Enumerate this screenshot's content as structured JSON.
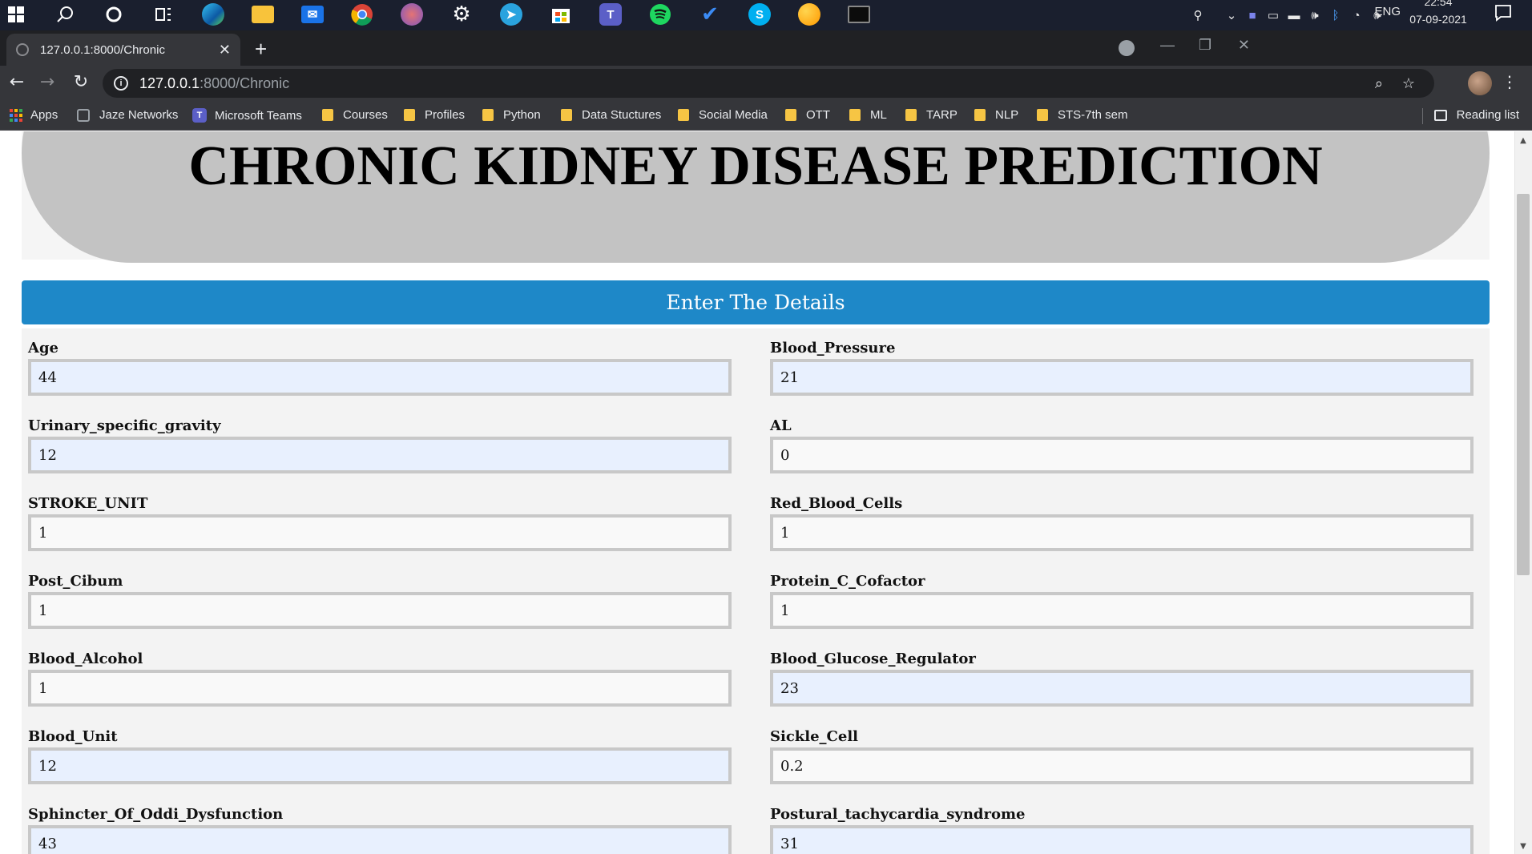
{
  "taskbar": {
    "icons": [
      "windows-start",
      "search",
      "cortana",
      "task-view",
      "edge",
      "file-explorer",
      "mail",
      "chrome",
      "paint",
      "settings",
      "telegram",
      "store",
      "teams",
      "spotify",
      "todo",
      "skype",
      "weather",
      "terminal"
    ],
    "tray": {
      "language": "ENG",
      "time": "22:54",
      "date": "07-09-2021"
    }
  },
  "browser": {
    "tab": {
      "title": "127.0.0.1:8000/Chronic"
    },
    "address": {
      "host": "127.0.0.1",
      "path": ":8000/Chronic"
    },
    "bookmarks": [
      {
        "label": "Apps",
        "type": "apps"
      },
      {
        "label": "Jaze Networks",
        "type": "page"
      },
      {
        "label": "Microsoft Teams",
        "type": "teams"
      },
      {
        "label": "Courses",
        "type": "folder"
      },
      {
        "label": "Profiles",
        "type": "folder"
      },
      {
        "label": "Python",
        "type": "folder"
      },
      {
        "label": "Data Stuctures",
        "type": "folder"
      },
      {
        "label": "Social Media",
        "type": "folder"
      },
      {
        "label": "OTT",
        "type": "folder"
      },
      {
        "label": "ML",
        "type": "folder"
      },
      {
        "label": "TARP",
        "type": "folder"
      },
      {
        "label": "NLP",
        "type": "folder"
      },
      {
        "label": "STS-7th sem",
        "type": "folder"
      }
    ],
    "reading_list": "Reading list"
  },
  "page": {
    "title": "CHRONIC KIDNEY DISEASE PREDICTION",
    "section_header": "Enter The Details",
    "fields": [
      {
        "label": "Age",
        "value": "44",
        "autofilled": true
      },
      {
        "label": "Blood_Pressure",
        "value": "21",
        "autofilled": true
      },
      {
        "label": "Urinary_specific_gravity",
        "value": "12",
        "autofilled": true
      },
      {
        "label": "AL",
        "value": "0",
        "autofilled": false
      },
      {
        "label": "STROKE_UNIT",
        "value": "1",
        "autofilled": false
      },
      {
        "label": "Red_Blood_Cells",
        "value": "1",
        "autofilled": false
      },
      {
        "label": "Post_Cibum",
        "value": "1",
        "autofilled": false
      },
      {
        "label": "Protein_C_Cofactor",
        "value": "1",
        "autofilled": false
      },
      {
        "label": "Blood_Alcohol",
        "value": "1",
        "autofilled": false
      },
      {
        "label": "Blood_Glucose_Regulator",
        "value": "23",
        "autofilled": true
      },
      {
        "label": "Blood_Unit",
        "value": "12",
        "autofilled": true
      },
      {
        "label": "Sickle_Cell",
        "value": "0.2",
        "autofilled": false
      },
      {
        "label": "Sphincter_Of_Oddi_Dysfunction",
        "value": "43",
        "autofilled": true
      },
      {
        "label": "Postural_tachycardia_syndrome",
        "value": "31",
        "autofilled": true
      }
    ]
  },
  "colors": {
    "header_bar": "#1e88c8",
    "hero_bg": "#c3c3c3",
    "autofill_bg": "#e8f0fe",
    "folder": "#f6c544"
  }
}
